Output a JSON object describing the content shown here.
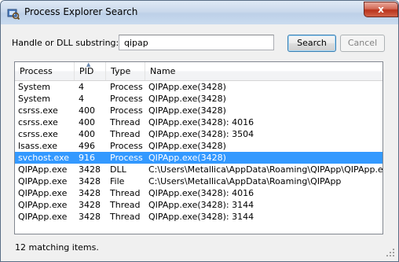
{
  "window": {
    "title": "Process Explorer Search",
    "close_glyph": "x"
  },
  "search": {
    "label": "Handle or DLL substring:",
    "value": "qipap",
    "search_label": "Search",
    "cancel_label": "Cancel"
  },
  "columns": [
    "Process",
    "PID",
    "Type",
    "Name"
  ],
  "sort_column": "PID",
  "rows": [
    {
      "process": "System",
      "pid": "4",
      "type": "Process",
      "name": "QIPApp.exe(3428)"
    },
    {
      "process": "System",
      "pid": "4",
      "type": "Process",
      "name": "QIPApp.exe(3428)"
    },
    {
      "process": "csrss.exe",
      "pid": "400",
      "type": "Process",
      "name": "QIPApp.exe(3428)"
    },
    {
      "process": "csrss.exe",
      "pid": "400",
      "type": "Thread",
      "name": "QIPApp.exe(3428): 4016"
    },
    {
      "process": "csrss.exe",
      "pid": "400",
      "type": "Thread",
      "name": "QIPApp.exe(3428): 3504"
    },
    {
      "process": "lsass.exe",
      "pid": "496",
      "type": "Process",
      "name": "QIPApp.exe(3428)"
    },
    {
      "process": "svchost.exe",
      "pid": "916",
      "type": "Process",
      "name": "QIPApp.exe(3428)",
      "selected": true
    },
    {
      "process": "QIPApp.exe",
      "pid": "3428",
      "type": "DLL",
      "name": "C:\\Users\\Metallica\\AppData\\Roaming\\QIPApp\\QIPApp.exe"
    },
    {
      "process": "QIPApp.exe",
      "pid": "3428",
      "type": "File",
      "name": "C:\\Users\\Metallica\\AppData\\Roaming\\QIPApp"
    },
    {
      "process": "QIPApp.exe",
      "pid": "3428",
      "type": "Thread",
      "name": "QIPApp.exe(3428): 4016"
    },
    {
      "process": "QIPApp.exe",
      "pid": "3428",
      "type": "Thread",
      "name": "QIPApp.exe(3428): 3144"
    },
    {
      "process": "QIPApp.exe",
      "pid": "3428",
      "type": "Thread",
      "name": "QIPApp.exe(3428): 3144"
    }
  ],
  "status": "12 matching items.",
  "colors": {
    "selection": "#3399ff",
    "title_gradient_top": "#dfe9f5",
    "close_button": "#c4402b"
  },
  "icons": {
    "app": "process-explorer-icon",
    "close": "close-icon",
    "sort": "sort-ascending-icon",
    "grip": "resize-grip-icon"
  }
}
